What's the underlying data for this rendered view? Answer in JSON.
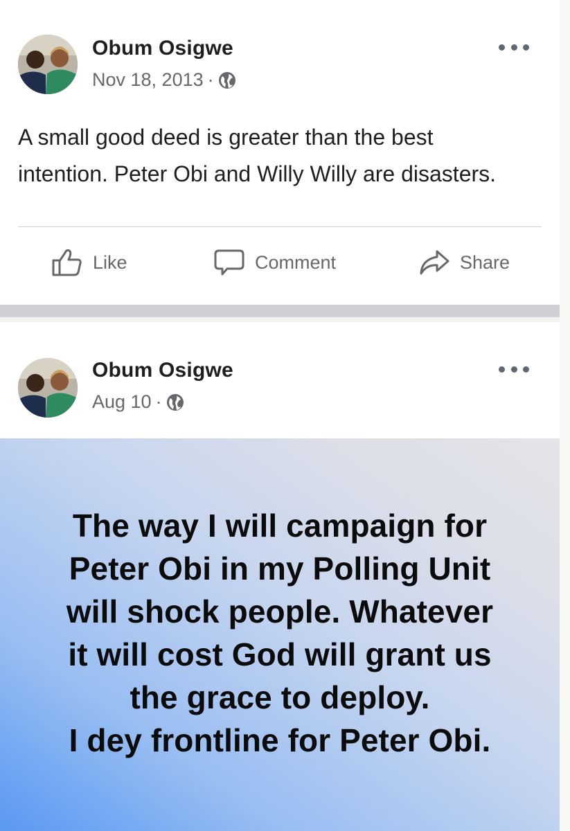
{
  "posts": [
    {
      "author": "Obum Osigwe",
      "date": "Nov 18, 2013",
      "separator": "·",
      "text": "A small good deed is greater than the best intention. Peter Obi and Willy Willy are disasters.",
      "actions": {
        "like": "Like",
        "comment": "Comment",
        "share": "Share"
      },
      "icons": [
        "globe-icon",
        "more-options-icon",
        "like-icon",
        "comment-icon",
        "share-icon"
      ]
    },
    {
      "author": "Obum Osigwe",
      "date": "Aug 10",
      "separator": "·",
      "background_text": "The way I will campaign for\nPeter Obi in my Polling Unit\nwill shock people. Whatever\nit will cost God will grant us\nthe grace to deploy.\nI dey frontline for Peter Obi.",
      "background_colors": [
        "#5a98f2",
        "#c6d5ef",
        "#e4e4e8"
      ],
      "icons": [
        "globe-icon",
        "more-options-icon"
      ]
    }
  ],
  "colors": {
    "text_primary": "#1c1e21",
    "text_secondary": "#65676b",
    "card_background": "#ffffff",
    "separator": "#cdd0d4"
  }
}
